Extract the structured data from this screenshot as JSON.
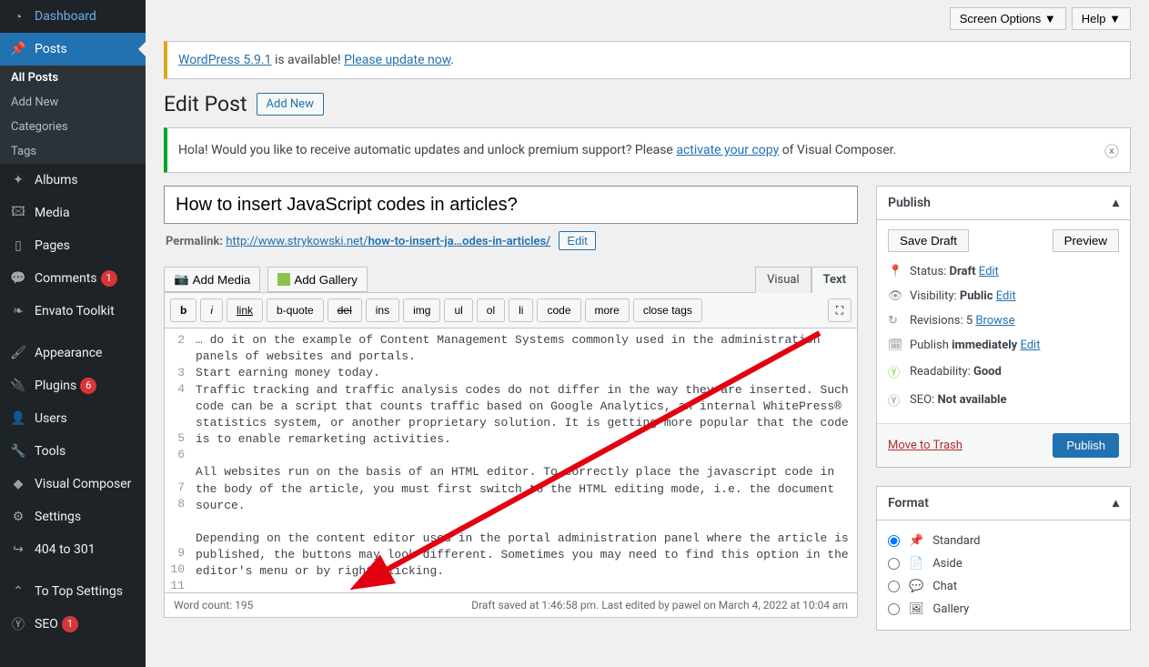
{
  "topbar": {
    "screen_options": "Screen Options ▼",
    "help": "Help ▼"
  },
  "sidebar": {
    "dashboard": "Dashboard",
    "posts": "Posts",
    "sub": {
      "all": "All Posts",
      "add": "Add New",
      "cat": "Categories",
      "tags": "Tags"
    },
    "albums": "Albums",
    "media": "Media",
    "pages": "Pages",
    "comments": "Comments",
    "comments_badge": "1",
    "envato": "Envato Toolkit",
    "appearance": "Appearance",
    "plugins": "Plugins",
    "plugins_badge": "6",
    "users": "Users",
    "tools": "Tools",
    "vc": "Visual Composer",
    "settings": "Settings",
    "redirect": "404 to 301",
    "totop": "To Top Settings",
    "seo": "SEO",
    "seo_badge": "1"
  },
  "notice_update": {
    "pre": "WordPress 5.9.1",
    "mid": " is available! ",
    "link": "Please update now",
    "dot": "."
  },
  "notice_vc": {
    "pre": "Hola! Would you like to receive automatic updates and unlock premium support? Please ",
    "link": "activate your copy",
    "post": " of Visual Composer."
  },
  "heading": "Edit Post",
  "add_new": "Add New",
  "title": "How to insert JavaScript codes in articles?",
  "permalink": {
    "label": "Permalink: ",
    "base": "http://www.strykowski.net/",
    "slug": "how-to-insert-ja…odes-in-articles/",
    "edit": "Edit"
  },
  "media": {
    "add_media": "Add Media",
    "add_gallery": "Add Gallery"
  },
  "editor_tabs": {
    "visual": "Visual",
    "text": "Text"
  },
  "toolbar": {
    "b": "b",
    "i": "i",
    "link": "link",
    "bquote": "b-quote",
    "del": "del",
    "ins": "ins",
    "img": "img",
    "ul": "ul",
    "ol": "ol",
    "li": "li",
    "code": "code",
    "more": "more",
    "close": "close tags"
  },
  "code_lines": [
    "… do it on the example of Content Management Systems commonly used in the administration panels of websites and portals.",
    "Start earning money today.",
    "Traffic tracking and traffic analysis codes do not differ in the way they are inserted. Such code can be a script that counts traffic based on Google Analytics, an internal WhitePress® statistics system, or another proprietary solution. It is getting more popular that the code is to enable remarketing activities.",
    "",
    "All websites run on the basis of an HTML editor. To correctly place the javascript code in the body of the article, you must first switch to the HTML editing mode, i.e. the document source.",
    "",
    "Depending on the content editor used in the portal administration panel where the article is published, the buttons may look different. Sometimes you may need to find this option in the editor's menu or by right-clicking.",
    "",
    "",
    ""
  ],
  "gutter_start": 2,
  "status_bar": {
    "word_count": "Word count: 195",
    "saved": "Draft saved at 1:46:58 pm. Last edited by pawel on March 4, 2022 at 10:04 am"
  },
  "publish": {
    "title": "Publish",
    "save_draft": "Save Draft",
    "preview": "Preview",
    "status_lbl": "Status: ",
    "status_val": "Draft",
    "edit": "Edit",
    "vis_lbl": "Visibility: ",
    "vis_val": "Public",
    "rev_lbl": "Revisions: ",
    "rev_val": "5",
    "browse": "Browse",
    "sched_lbl": "Publish ",
    "sched_val": "immediately",
    "read_lbl": "Readability: ",
    "read_val": "Good",
    "seo_lbl": "SEO: ",
    "seo_val": "Not available",
    "trash": "Move to Trash",
    "publish_btn": "Publish"
  },
  "format": {
    "title": "Format",
    "standard": "Standard",
    "aside": "Aside",
    "chat": "Chat",
    "gallery": "Gallery"
  }
}
